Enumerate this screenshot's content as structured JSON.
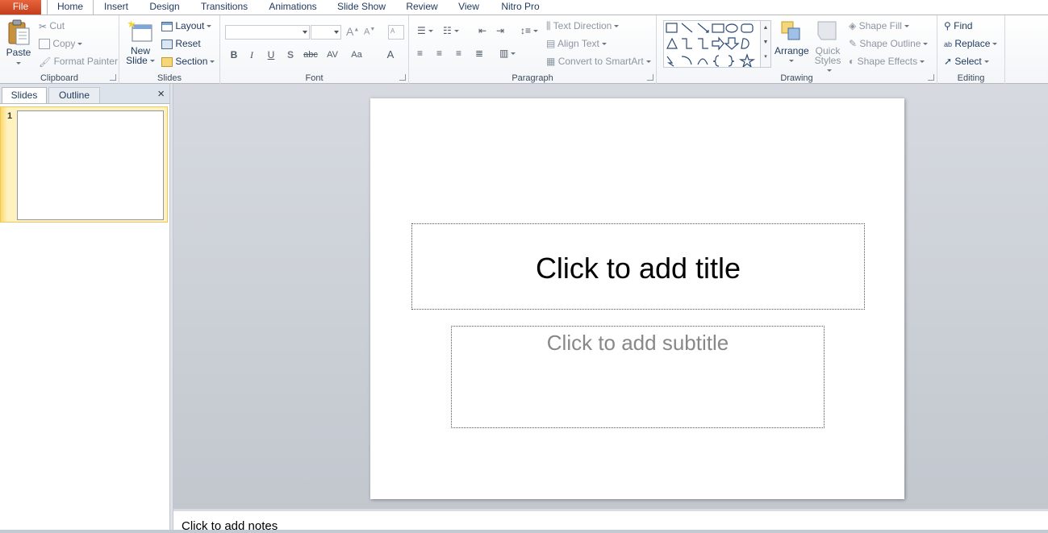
{
  "tabs": {
    "file": "File",
    "home": "Home",
    "insert": "Insert",
    "design": "Design",
    "transitions": "Transitions",
    "animations": "Animations",
    "slideshow": "Slide Show",
    "review": "Review",
    "view": "View",
    "nitro": "Nitro Pro"
  },
  "clipboard": {
    "paste": "Paste",
    "cut": "Cut",
    "copy": "Copy",
    "format_painter": "Format Painter",
    "label": "Clipboard"
  },
  "slides_group": {
    "new_slide_1": "New",
    "new_slide_2": "Slide",
    "layout": "Layout",
    "reset": "Reset",
    "section": "Section",
    "label": "Slides"
  },
  "font": {
    "label": "Font",
    "grow": "A",
    "shrink": "A",
    "bold": "B",
    "italic": "I",
    "underline": "U",
    "shadow": "S",
    "strike": "abc",
    "spacing": "AV",
    "case": "Aa",
    "color": "A"
  },
  "paragraph": {
    "label": "Paragraph",
    "text_direction": "Text Direction",
    "align_text": "Align Text",
    "smartart": "Convert to SmartArt"
  },
  "drawing": {
    "label": "Drawing",
    "arrange": "Arrange",
    "quick_styles_1": "Quick",
    "quick_styles_2": "Styles",
    "shape_fill": "Shape Fill",
    "shape_outline": "Shape Outline",
    "shape_effects": "Shape Effects"
  },
  "editing": {
    "label": "Editing",
    "find": "Find",
    "replace": "Replace",
    "select": "Select"
  },
  "panel": {
    "slides_tab": "Slides",
    "outline_tab": "Outline",
    "close": "×",
    "slide_number": "1"
  },
  "slide": {
    "title_placeholder": "Click to add title",
    "subtitle_placeholder": "Click to add subtitle"
  },
  "notes": {
    "placeholder": "Click to add notes"
  },
  "colors": {
    "file_tab": "#d24726",
    "accent": "#1e395b",
    "thumb_selected": "#fde99a"
  }
}
